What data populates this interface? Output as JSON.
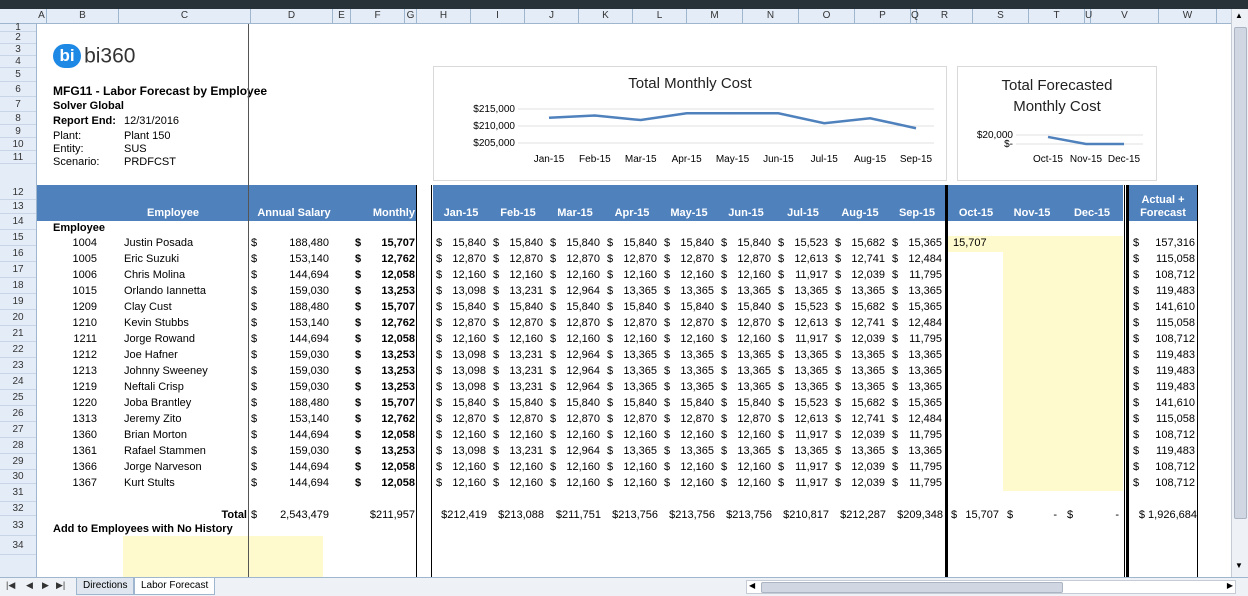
{
  "columns": [
    "A",
    "B",
    "C",
    "D",
    "E",
    "F",
    "G",
    "H",
    "I",
    "J",
    "K",
    "L",
    "M",
    "N",
    "O",
    "P",
    "Q",
    "R",
    "S",
    "T",
    "U",
    "V",
    "W"
  ],
  "rows": [
    "1",
    "2",
    "3",
    "4",
    "5",
    "6",
    "7",
    "8",
    "9",
    "10",
    "11",
    "12",
    "13",
    "14",
    "15",
    "16",
    "17",
    "18",
    "19",
    "20",
    "21",
    "22",
    "23",
    "24",
    "25",
    "26",
    "27",
    "28",
    "29",
    "30",
    "31",
    "32",
    "33",
    "34"
  ],
  "logo": "bi360",
  "report": {
    "title": "MFG11 - Labor Forecast by Employee",
    "company": "Solver Global",
    "report_end_label": "Report End:",
    "report_end_value": "12/31/2016",
    "plant_label": "Plant:",
    "plant_value": "Plant 150",
    "entity_label": "Entity:",
    "entity_value": "SUS",
    "scenario_label": "Scenario:",
    "scenario_value": "PRDFCST"
  },
  "headers": {
    "employee": "Employee",
    "annual_salary": "Annual Salary",
    "monthly": "Monthly",
    "actual_months": [
      "Jan-15",
      "Feb-15",
      "Mar-15",
      "Apr-15",
      "May-15",
      "Jun-15",
      "Jul-15",
      "Aug-15",
      "Sep-15"
    ],
    "forecast_months": [
      "Oct-15",
      "Nov-15",
      "Dec-15"
    ],
    "total_line1": "Actual +",
    "total_line2": "Forecast"
  },
  "employee_section_label": "Employee",
  "employees": [
    {
      "id": "1004",
      "name": "Justin Posada",
      "salary": "188,480",
      "monthly": "15,707",
      "m": [
        "15,840",
        "15,840",
        "15,840",
        "15,840",
        "15,840",
        "15,840",
        "15,523",
        "15,682",
        "15,365"
      ],
      "oct": "15,707",
      "total": "157,316"
    },
    {
      "id": "1005",
      "name": "Eric Suzuki",
      "salary": "153,140",
      "monthly": "12,762",
      "m": [
        "12,870",
        "12,870",
        "12,870",
        "12,870",
        "12,870",
        "12,870",
        "12,613",
        "12,741",
        "12,484"
      ],
      "oct": "",
      "total": "115,058"
    },
    {
      "id": "1006",
      "name": "Chris Molina",
      "salary": "144,694",
      "monthly": "12,058",
      "m": [
        "12,160",
        "12,160",
        "12,160",
        "12,160",
        "12,160",
        "12,160",
        "11,917",
        "12,039",
        "11,795"
      ],
      "oct": "",
      "total": "108,712"
    },
    {
      "id": "1015",
      "name": "Orlando Iannetta",
      "salary": "159,030",
      "monthly": "13,253",
      "m": [
        "13,098",
        "13,231",
        "12,964",
        "13,365",
        "13,365",
        "13,365",
        "13,365",
        "13,365",
        "13,365"
      ],
      "oct": "",
      "total": "119,483"
    },
    {
      "id": "1209",
      "name": "Clay Cust",
      "salary": "188,480",
      "monthly": "15,707",
      "m": [
        "15,840",
        "15,840",
        "15,840",
        "15,840",
        "15,840",
        "15,840",
        "15,523",
        "15,682",
        "15,365"
      ],
      "oct": "",
      "total": "141,610"
    },
    {
      "id": "1210",
      "name": "Kevin Stubbs",
      "salary": "153,140",
      "monthly": "12,762",
      "m": [
        "12,870",
        "12,870",
        "12,870",
        "12,870",
        "12,870",
        "12,870",
        "12,613",
        "12,741",
        "12,484"
      ],
      "oct": "",
      "total": "115,058"
    },
    {
      "id": "1211",
      "name": "Jorge Rowand",
      "salary": "144,694",
      "monthly": "12,058",
      "m": [
        "12,160",
        "12,160",
        "12,160",
        "12,160",
        "12,160",
        "12,160",
        "11,917",
        "12,039",
        "11,795"
      ],
      "oct": "",
      "total": "108,712"
    },
    {
      "id": "1212",
      "name": "Joe Hafner",
      "salary": "159,030",
      "monthly": "13,253",
      "m": [
        "13,098",
        "13,231",
        "12,964",
        "13,365",
        "13,365",
        "13,365",
        "13,365",
        "13,365",
        "13,365"
      ],
      "oct": "",
      "total": "119,483"
    },
    {
      "id": "1213",
      "name": "Johnny Sweeney",
      "salary": "159,030",
      "monthly": "13,253",
      "m": [
        "13,098",
        "13,231",
        "12,964",
        "13,365",
        "13,365",
        "13,365",
        "13,365",
        "13,365",
        "13,365"
      ],
      "oct": "",
      "total": "119,483"
    },
    {
      "id": "1219",
      "name": "Neftali Crisp",
      "salary": "159,030",
      "monthly": "13,253",
      "m": [
        "13,098",
        "13,231",
        "12,964",
        "13,365",
        "13,365",
        "13,365",
        "13,365",
        "13,365",
        "13,365"
      ],
      "oct": "",
      "total": "119,483"
    },
    {
      "id": "1220",
      "name": "Joba Brantley",
      "salary": "188,480",
      "monthly": "15,707",
      "m": [
        "15,840",
        "15,840",
        "15,840",
        "15,840",
        "15,840",
        "15,840",
        "15,523",
        "15,682",
        "15,365"
      ],
      "oct": "",
      "total": "141,610"
    },
    {
      "id": "1313",
      "name": "Jeremy Zito",
      "salary": "153,140",
      "monthly": "12,762",
      "m": [
        "12,870",
        "12,870",
        "12,870",
        "12,870",
        "12,870",
        "12,870",
        "12,613",
        "12,741",
        "12,484"
      ],
      "oct": "",
      "total": "115,058"
    },
    {
      "id": "1360",
      "name": "Brian Morton",
      "salary": "144,694",
      "monthly": "12,058",
      "m": [
        "12,160",
        "12,160",
        "12,160",
        "12,160",
        "12,160",
        "12,160",
        "11,917",
        "12,039",
        "11,795"
      ],
      "oct": "",
      "total": "108,712"
    },
    {
      "id": "1361",
      "name": "Rafael Stammen",
      "salary": "159,030",
      "monthly": "13,253",
      "m": [
        "13,098",
        "13,231",
        "12,964",
        "13,365",
        "13,365",
        "13,365",
        "13,365",
        "13,365",
        "13,365"
      ],
      "oct": "",
      "total": "119,483"
    },
    {
      "id": "1366",
      "name": "Jorge Narveson",
      "salary": "144,694",
      "monthly": "12,058",
      "m": [
        "12,160",
        "12,160",
        "12,160",
        "12,160",
        "12,160",
        "12,160",
        "11,917",
        "12,039",
        "11,795"
      ],
      "oct": "",
      "total": "108,712"
    },
    {
      "id": "1367",
      "name": "Kurt Stults",
      "salary": "144,694",
      "monthly": "12,058",
      "m": [
        "12,160",
        "12,160",
        "12,160",
        "12,160",
        "12,160",
        "12,160",
        "11,917",
        "12,039",
        "11,795"
      ],
      "oct": "",
      "total": "108,712"
    }
  ],
  "totals": {
    "label": "Total",
    "salary": "2,543,479",
    "monthly": "$211,957",
    "months": [
      "$212,419",
      "$213,088",
      "$211,751",
      "$213,756",
      "$213,756",
      "$213,756",
      "$210,817",
      "$212,287",
      "$209,348"
    ],
    "oct": "15,707",
    "nov": "-",
    "dec": "-",
    "total": "$ 1,926,684"
  },
  "currency_symbol": "$",
  "add_label": "Add to Employees with No History",
  "sheet_tabs": [
    "Directions",
    "Labor Forecast"
  ],
  "active_tab": "Labor Forecast",
  "chart_data": [
    {
      "type": "line",
      "title": "Total Monthly Cost",
      "categories": [
        "Jan-15",
        "Feb-15",
        "Mar-15",
        "Apr-15",
        "May-15",
        "Jun-15",
        "Jul-15",
        "Aug-15",
        "Sep-15"
      ],
      "values": [
        212419,
        213088,
        211751,
        213756,
        213756,
        213756,
        210817,
        212287,
        209348
      ],
      "y_ticks": [
        "$215,000",
        "$210,000",
        "$205,000"
      ],
      "ylim": [
        205000,
        215000
      ],
      "color": "#4f81bd"
    },
    {
      "type": "line",
      "title": "Total Forecasted Monthly Cost",
      "categories": [
        "Oct-15",
        "Nov-15",
        "Dec-15"
      ],
      "values": [
        15707,
        0,
        0
      ],
      "y_ticks": [
        "$20,000",
        "$-"
      ],
      "ylim": [
        0,
        20000
      ],
      "color": "#4f81bd"
    }
  ],
  "colors": {
    "header_blue": "#4f81bd",
    "input_yellow": "#fffacd",
    "line_blue": "#4f81bd"
  }
}
